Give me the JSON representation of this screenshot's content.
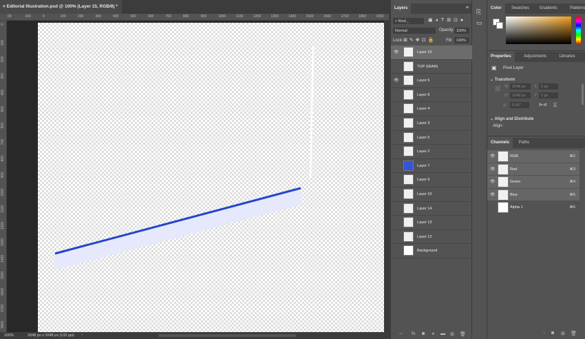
{
  "document": {
    "tab_title": "Editorial Illustration.psd @ 100% (Layer 15, RGB/8) *",
    "close_glyph": "×"
  },
  "rulers": {
    "top": [
      "00",
      "100",
      "0",
      "100",
      "200",
      "300",
      "400",
      "500",
      "600",
      "700",
      "800",
      "900",
      "1000",
      "1100",
      "1200",
      "1300",
      "1400",
      "1500",
      "1600",
      "1700",
      "1800",
      "1900"
    ],
    "left": [
      "0",
      "100",
      "200",
      "300",
      "400",
      "500",
      "600",
      "700",
      "800",
      "900",
      "1000",
      "1100",
      "1200",
      "1300",
      "1400",
      "1500",
      "1600",
      "1700",
      "1800"
    ]
  },
  "status": {
    "zoom": "100%",
    "doc_size": "2048 px x 2048 px (132 ppi)",
    "arrow": "›"
  },
  "layers_panel": {
    "tab": "Layers",
    "filter": "Kind",
    "blend_mode": "Normal",
    "opacity_label": "Opacity:",
    "opacity": "100%",
    "lock_label": "Lock:",
    "fill_label": "Fill:",
    "fill": "100%",
    "layers": [
      {
        "name": "Layer 15",
        "visible": true,
        "selected": true
      },
      {
        "name": "TOP GRAIN",
        "visible": false
      },
      {
        "name": "Layer 6",
        "visible": true
      },
      {
        "name": "Layer 8",
        "visible": false
      },
      {
        "name": "Layer 4",
        "visible": false
      },
      {
        "name": "Layer 3",
        "visible": false
      },
      {
        "name": "Layer 5",
        "visible": false
      },
      {
        "name": "Layer 2",
        "visible": false
      },
      {
        "name": "Layer 7",
        "visible": false
      },
      {
        "name": "Layer 9",
        "visible": false
      },
      {
        "name": "Layer 10",
        "visible": false
      },
      {
        "name": "Layer 14",
        "visible": false
      },
      {
        "name": "Layer 13",
        "visible": false
      },
      {
        "name": "Layer 12",
        "visible": false
      },
      {
        "name": "Background",
        "visible": false
      }
    ]
  },
  "color_panel": {
    "tabs": [
      "Color",
      "Swatches",
      "Gradients",
      "Patterns"
    ],
    "hue_color": "#f0a020"
  },
  "properties_panel": {
    "tabs": [
      "Properties",
      "Adjustments",
      "Libraries"
    ],
    "layer_type": "Pixel Layer",
    "transform_title": "Transform",
    "w_label": "W",
    "w": "2048 px",
    "h_label": "H",
    "h": "2048 px",
    "x_label": "X",
    "x": "0 px",
    "y_label": "Y",
    "y": "0 px",
    "angle": "0.00°",
    "align_title": "Align and Distribute",
    "align_label": "Align:"
  },
  "channels_panel": {
    "tabs": [
      "Channels",
      "Paths"
    ],
    "channels": [
      {
        "name": "RGB",
        "shortcut": "⌘2",
        "visible": true
      },
      {
        "name": "Red",
        "shortcut": "⌘3",
        "visible": true
      },
      {
        "name": "Green",
        "shortcut": "⌘4",
        "visible": true
      },
      {
        "name": "Blue",
        "shortcut": "⌘5",
        "visible": true
      },
      {
        "name": "Alpha 1",
        "shortcut": "⌘6",
        "visible": false
      }
    ]
  },
  "colors": {
    "stroke_blue": "#2244cc",
    "fill_lavender": "#e6e8fb",
    "panel": "#535353",
    "pasteboard": "#282828"
  }
}
